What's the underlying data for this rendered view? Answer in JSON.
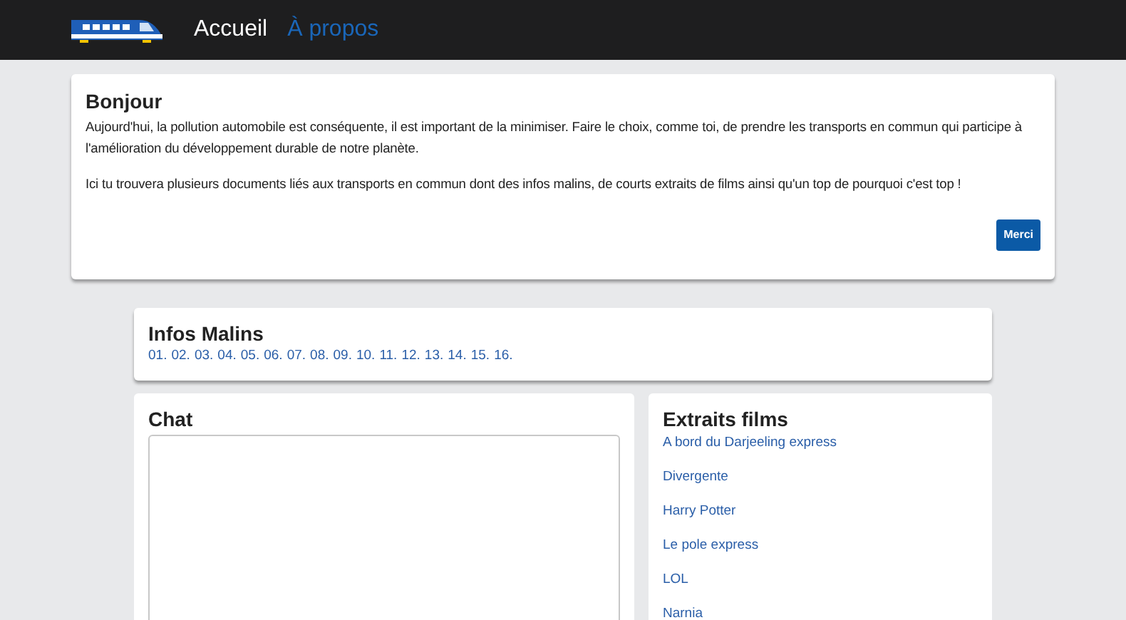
{
  "nav": {
    "items": [
      {
        "label": "Accueil",
        "selected": true
      },
      {
        "label": "À propos",
        "selected": false
      }
    ]
  },
  "intro": {
    "title": "Bonjour",
    "paragraphs": [
      "Aujourd'hui, la pollution automobile est conséquente, il est important de la minimiser. Faire le choix, comme toi, de prendre les transports en commun qui participe à l'amélioration du développement durable de notre planète.",
      "Ici tu trouvera plusieurs documents liés aux transports en commun dont des infos malins, de courts extraits de films ainsi qu'un top de pourquoi c'est top !"
    ],
    "button": "Merci"
  },
  "infos": {
    "title": "Infos Malins",
    "links": [
      "01.",
      "02.",
      "03.",
      "04.",
      "05.",
      "06.",
      "07.",
      "08.",
      "09.",
      "10.",
      "11.",
      "12.",
      "13.",
      "14.",
      "15.",
      "16."
    ]
  },
  "chat": {
    "title": "Chat"
  },
  "films": {
    "title": "Extraits films",
    "links": [
      "A bord du Darjeeling express",
      "Divergente",
      "Harry Potter",
      "Le pole express",
      "LOL",
      "Narnia"
    ]
  }
}
